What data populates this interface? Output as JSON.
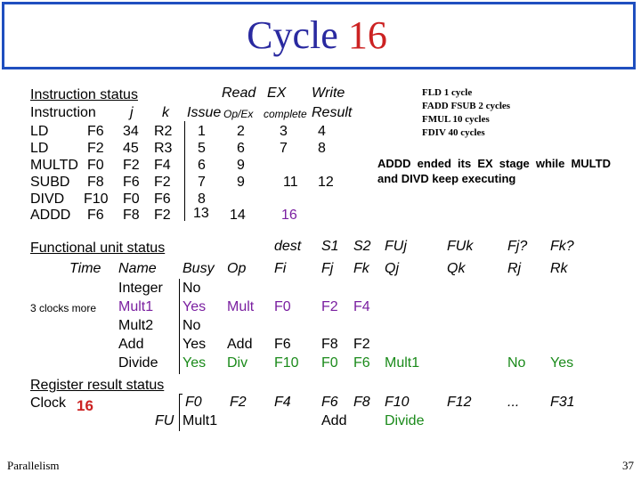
{
  "title_prefix": "Cycle ",
  "title_number": "16",
  "instruction_status": {
    "heading": "Instruction status",
    "col_instruction": "Instruction",
    "col_j": "j",
    "col_k": "k",
    "col_read": "Read",
    "col_ex": "EX",
    "col_write": "Write",
    "col_issue_row": "Issue",
    "col_opex": "Op/Ex",
    "col_complete": "complete",
    "col_result": "Result",
    "rows": [
      {
        "op": "LD",
        "dest": "F6",
        "j": "34",
        "k": "R2",
        "issue": "1",
        "read": "2",
        "ex": "3",
        "write": "4"
      },
      {
        "op": "LD",
        "dest": "F2",
        "j": "45",
        "k": "R3",
        "issue": "5",
        "read": "6",
        "ex": "7",
        "write": "8"
      },
      {
        "op": "MULTD",
        "dest": "F0",
        "j": "F2",
        "k": "F4",
        "issue": "6",
        "read": "9",
        "ex": "",
        "write": ""
      },
      {
        "op": "SUBD",
        "dest": "F8",
        "j": "F6",
        "k": "F2",
        "issue": "7",
        "read": "9",
        "ex": "11",
        "write": "12"
      },
      {
        "op": "DIVD",
        "dest": "F10",
        "j": "F0",
        "k": "F6",
        "issue": "8",
        "read": "",
        "ex": "",
        "write": ""
      },
      {
        "op": "ADDD",
        "dest": "F6",
        "j": "F8",
        "k": "F2",
        "issue": "13",
        "read": "14",
        "ex": "16",
        "write": ""
      }
    ]
  },
  "latency_notes": [
    "FLD 1 cycle",
    "FADD FSUB 2 cycles",
    "FMUL 10 cycles",
    "FDIV 40 cycles"
  ],
  "note": "ADDD ended its EX stage while MULTD and DIVD keep executing",
  "functional_unit_status": {
    "heading": "Functional unit status",
    "col_time": "Time",
    "col_name": "Name",
    "col_busy": "Busy",
    "col_op": "Op",
    "col_dest": "dest",
    "col_fi": "Fi",
    "col_s1": "S1",
    "col_fj": "Fj",
    "col_s2": "S2",
    "col_fk": "Fk",
    "col_fuj": "FUj",
    "col_qj": "Qj",
    "col_fuk": "FUk",
    "col_qk": "Qk",
    "col_fjq": "Fj?",
    "col_rj": "Rj",
    "col_fkq": "Fk?",
    "col_rk": "Rk",
    "rows": [
      {
        "time": "",
        "name": "Integer",
        "busy": "No",
        "op": "",
        "fi": "",
        "fj": "",
        "fk": "",
        "qj": "",
        "qk": "",
        "rj": "",
        "rk": ""
      },
      {
        "time": "3 clocks more",
        "name": "Mult1",
        "busy": "Yes",
        "op": "Mult",
        "fi": "F0",
        "fj": "F2",
        "fk": "F4",
        "qj": "",
        "qk": "",
        "rj": "",
        "rk": ""
      },
      {
        "time": "",
        "name": "Mult2",
        "busy": "No",
        "op": "",
        "fi": "",
        "fj": "",
        "fk": "",
        "qj": "",
        "qk": "",
        "rj": "",
        "rk": ""
      },
      {
        "time": "",
        "name": "Add",
        "busy": "Yes",
        "op": "Add",
        "fi": "F6",
        "fj": "F8",
        "fk": "F2",
        "qj": "",
        "qk": "",
        "rj": "",
        "rk": ""
      },
      {
        "time": "",
        "name": "Divide",
        "busy": "Yes",
        "op": "Div",
        "fi": "F10",
        "fj": "F0",
        "fk": "F6",
        "qj": "Mult1",
        "qk": "",
        "rj": "No",
        "rk": "Yes"
      }
    ]
  },
  "register_result_status": {
    "heading": "Register result status",
    "clock_label": "Clock",
    "clock_value": "16",
    "fu_label": "FU",
    "registers": [
      {
        "reg": "F0",
        "fu": "Mult1"
      },
      {
        "reg": "F2",
        "fu": ""
      },
      {
        "reg": "F4",
        "fu": ""
      },
      {
        "reg": "F6",
        "fu": "Add"
      },
      {
        "reg": "F8",
        "fu": ""
      },
      {
        "reg": "F10",
        "fu": "Divide"
      },
      {
        "reg": "F12",
        "fu": ""
      },
      {
        "reg": "...",
        "fu": ""
      },
      {
        "reg": "F31",
        "fu": ""
      }
    ]
  },
  "footer_left": "Parallelism",
  "page_number": "37"
}
